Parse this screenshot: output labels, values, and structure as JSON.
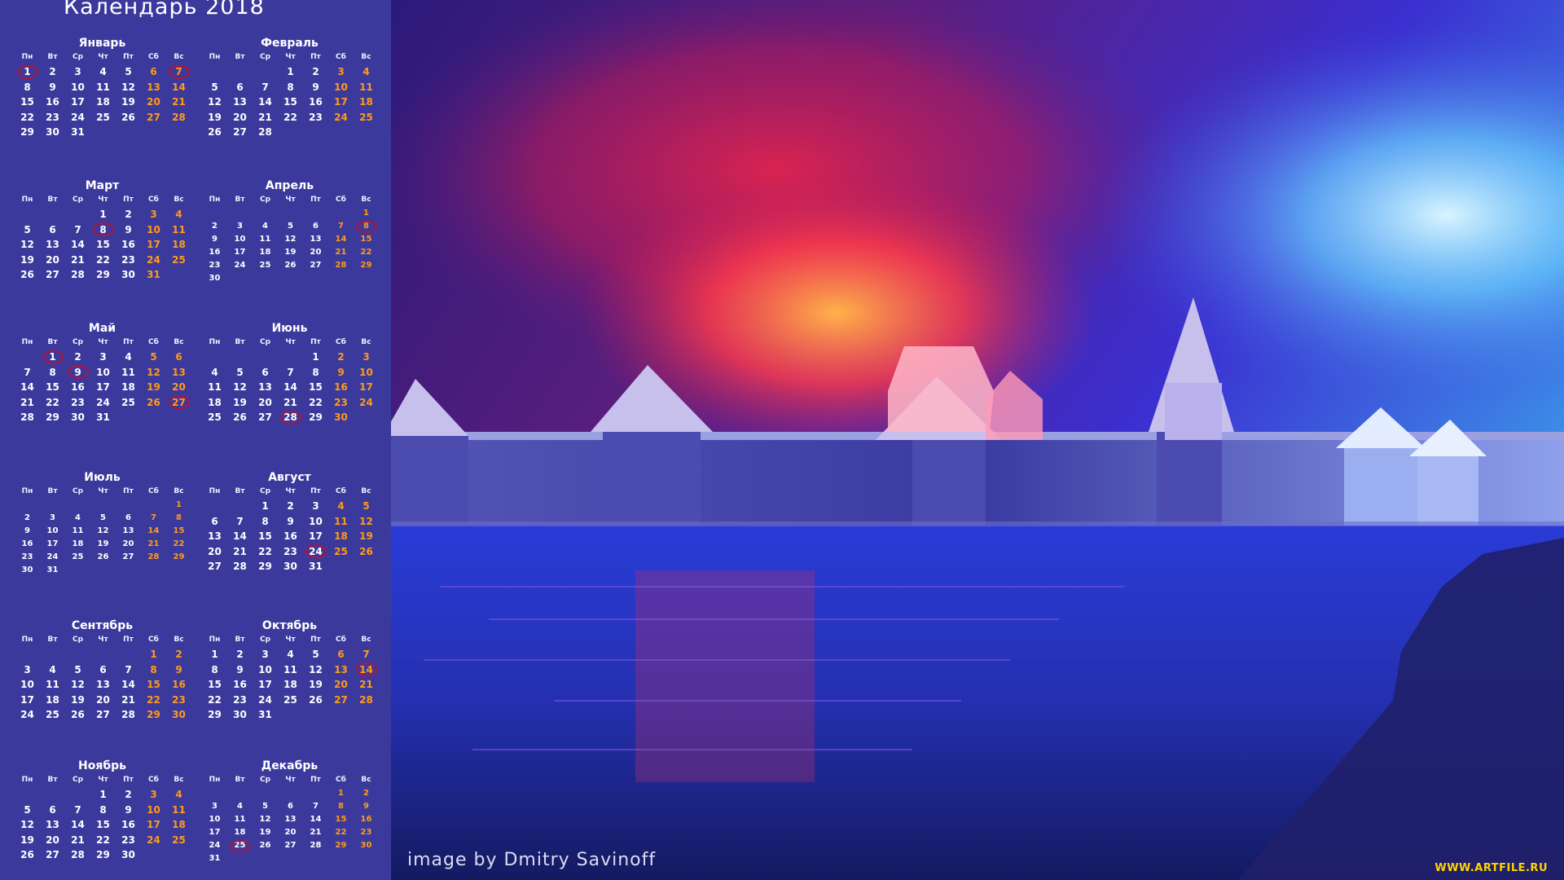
{
  "calendar": {
    "title": "Календарь 2018",
    "weekdays": [
      "Пн",
      "Вт",
      "Ср",
      "Чт",
      "Пт",
      "Сб",
      "Вс"
    ],
    "months": [
      {
        "name": "Январь",
        "offset": 0,
        "days": 31,
        "highlighted": [
          1,
          7
        ]
      },
      {
        "name": "Февраль",
        "offset": 3,
        "days": 28,
        "highlighted": []
      },
      {
        "name": "Март",
        "offset": 3,
        "days": 31,
        "highlighted": [
          8
        ]
      },
      {
        "name": "Апрель",
        "offset": 6,
        "days": 30,
        "highlighted": [
          8
        ]
      },
      {
        "name": "Май",
        "offset": 1,
        "days": 31,
        "highlighted": [
          1,
          9,
          27
        ]
      },
      {
        "name": "Июнь",
        "offset": 4,
        "days": 30,
        "highlighted": [
          28
        ]
      },
      {
        "name": "Июль",
        "offset": 6,
        "days": 31,
        "highlighted": []
      },
      {
        "name": "Август",
        "offset": 2,
        "days": 31,
        "highlighted": [
          24
        ]
      },
      {
        "name": "Сентябрь",
        "offset": 5,
        "days": 30,
        "highlighted": []
      },
      {
        "name": "Октябрь",
        "offset": 0,
        "days": 31,
        "highlighted": [
          14
        ]
      },
      {
        "name": "Ноябрь",
        "offset": 3,
        "days": 30,
        "highlighted": []
      },
      {
        "name": "Декабрь",
        "offset": 5,
        "days": 31,
        "highlighted": [
          25
        ]
      }
    ]
  },
  "image": {
    "credit": "image by Dmitry Savinoff",
    "watermark": "WWW.ARTFILE.RU",
    "description_icon": "fortress-sunset-icon"
  },
  "colors": {
    "panel": "#3b3a9c",
    "weekend": "#ff9b1a",
    "highlight_ring": "#b0143a"
  }
}
